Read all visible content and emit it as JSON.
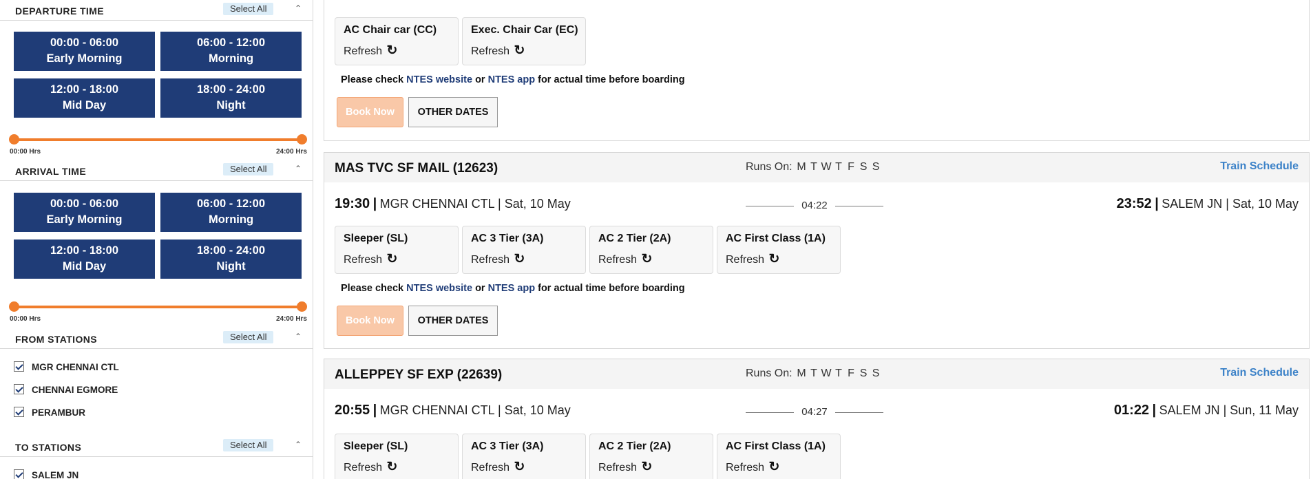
{
  "sidebar": {
    "departure": {
      "title": "DEPARTURE TIME",
      "select_all": "Select All",
      "slots": [
        {
          "range": "00:00 - 06:00",
          "label": "Early Morning"
        },
        {
          "range": "06:00 - 12:00",
          "label": "Morning"
        },
        {
          "range": "12:00 - 18:00",
          "label": "Mid Day"
        },
        {
          "range": "18:00 - 24:00",
          "label": "Night"
        }
      ],
      "slider": {
        "min_label": "00:00 Hrs",
        "max_label": "24:00 Hrs"
      }
    },
    "arrival": {
      "title": "ARRIVAL TIME",
      "select_all": "Select All",
      "slots": [
        {
          "range": "00:00 - 06:00",
          "label": "Early Morning"
        },
        {
          "range": "06:00 - 12:00",
          "label": "Morning"
        },
        {
          "range": "12:00 - 18:00",
          "label": "Mid Day"
        },
        {
          "range": "18:00 - 24:00",
          "label": "Night"
        }
      ],
      "slider": {
        "min_label": "00:00 Hrs",
        "max_label": "24:00 Hrs"
      }
    },
    "from_stations": {
      "title": "FROM STATIONS",
      "select_all": "Select All",
      "items": [
        "MGR CHENNAI CTL",
        "CHENNAI EGMORE",
        "PERAMBUR"
      ]
    },
    "to_stations": {
      "title": "TO STATIONS",
      "select_all": "Select All",
      "items": [
        "SALEM JN"
      ]
    },
    "collapse_icon": "chevron-up-icon"
  },
  "main": {
    "refresh_label": "Refresh",
    "refresh_icon": "refresh-icon",
    "notice": {
      "prefix": "Please check",
      "link1": "NTES website",
      "or": "or",
      "link2": "NTES app",
      "suffix": "for actual time before boarding"
    },
    "book_now": "Book Now",
    "other_dates": "OTHER DATES",
    "runs_on_label": "Runs On:",
    "days": [
      "M",
      "T",
      "W",
      "T",
      "F",
      "S",
      "S"
    ],
    "schedule_link": "Train Schedule",
    "first_card": {
      "classes": [
        "AC Chair car (CC)",
        "Exec. Chair Car (EC)"
      ]
    },
    "trains": [
      {
        "name": "MAS TVC SF MAIL (12623)",
        "dep_time": "19:30",
        "dep_station": "MGR CHENNAI CTL | Sat, 10 May",
        "duration": "04:22",
        "arr_time": "23:52",
        "arr_station": "SALEM JN | Sat, 10 May",
        "classes": [
          "Sleeper (SL)",
          "AC 3 Tier (3A)",
          "AC 2 Tier (2A)",
          "AC First Class (1A)"
        ]
      },
      {
        "name": "ALLEPPEY SF EXP (22639)",
        "dep_time": "20:55",
        "dep_station": "MGR CHENNAI CTL | Sat, 10 May",
        "duration": "04:27",
        "arr_time": "01:22",
        "arr_station": "SALEM JN | Sun, 11 May",
        "classes": [
          "Sleeper (SL)",
          "AC 3 Tier (3A)",
          "AC 2 Tier (2A)",
          "AC First Class (1A)"
        ]
      }
    ]
  },
  "colors": {
    "time_button": "#1f3c77",
    "slider": "#f07d2c",
    "schedule_link": "#3c82c8",
    "book_now": "#f9c8a8"
  }
}
